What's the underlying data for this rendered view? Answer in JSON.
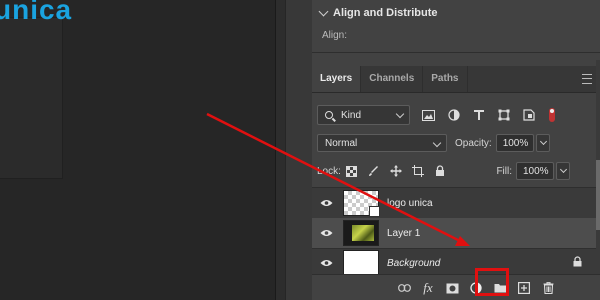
{
  "logo": {
    "text_main": "unica",
    "color_main": "#1aa3e0",
    "color_accent": "#f26b21"
  },
  "align_panel": {
    "title": "Align and Distribute",
    "align_label": "Align:"
  },
  "tabs": [
    {
      "label": "Layers",
      "active": true
    },
    {
      "label": "Channels",
      "active": false
    },
    {
      "label": "Paths",
      "active": false
    }
  ],
  "filter": {
    "kind_label": "Kind",
    "icons": [
      "image-filter-icon",
      "adjustment-filter-icon",
      "type-filter-icon",
      "shape-filter-icon",
      "smart-object-filter-icon"
    ]
  },
  "blend": {
    "mode": "Normal",
    "opacity_label": "Opacity:",
    "opacity_value": "100%",
    "fill_label": "Fill:",
    "fill_value": "100%"
  },
  "lock": {
    "label": "Lock:"
  },
  "layers": [
    {
      "name": "logo unica",
      "visible": true,
      "selected": false,
      "thumb": "transparent"
    },
    {
      "name": "Layer 1",
      "visible": true,
      "selected": true,
      "thumb": "image"
    },
    {
      "name": "Background",
      "visible": true,
      "selected": false,
      "thumb": "white",
      "locked": true
    }
  ],
  "bottom_icons": [
    "link-icon",
    "fx-icon",
    "mask-icon",
    "adjustment-layer-icon",
    "group-icon",
    "new-layer-icon",
    "trash-icon"
  ],
  "annotation": {
    "highlight_color": "#e01010",
    "arrow_color": "#e01010"
  }
}
